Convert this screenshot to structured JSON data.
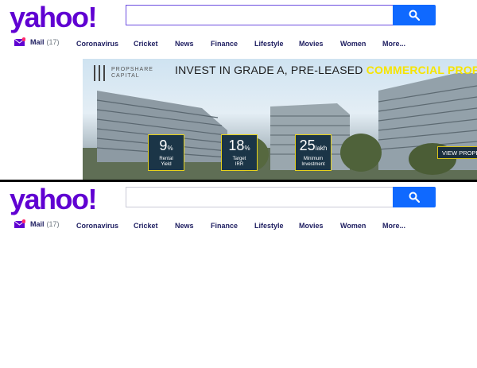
{
  "logo": "yahoo!",
  "search": {
    "placeholder": "",
    "value": ""
  },
  "nav": {
    "mail_label": "Mail",
    "mail_count": "(17)",
    "items": [
      "Coronavirus",
      "Cricket",
      "News",
      "Finance",
      "Lifestyle",
      "Movies",
      "Women",
      "More..."
    ]
  },
  "banner": {
    "brand_line1": "PROPSHARE",
    "brand_line2": "CAPITAL",
    "headline_prefix": "INVEST IN GRADE A, PRE-LEASED ",
    "headline_highlight": "COMMERCIAL PROPERT",
    "stats": [
      {
        "value": "9",
        "unit": "%",
        "label1": "Rental",
        "label2": "Yield"
      },
      {
        "value": "18",
        "unit": "%",
        "label1": "Target",
        "label2": "IRR"
      },
      {
        "value": "25",
        "unit": "lakh",
        "label1": "Minimum",
        "label2": "Investment"
      }
    ],
    "cta": "VIEW PROPE"
  },
  "colors": {
    "brand_purple": "#6001d2",
    "search_blue": "#0f69ff",
    "banner_highlight": "#f6e400"
  }
}
